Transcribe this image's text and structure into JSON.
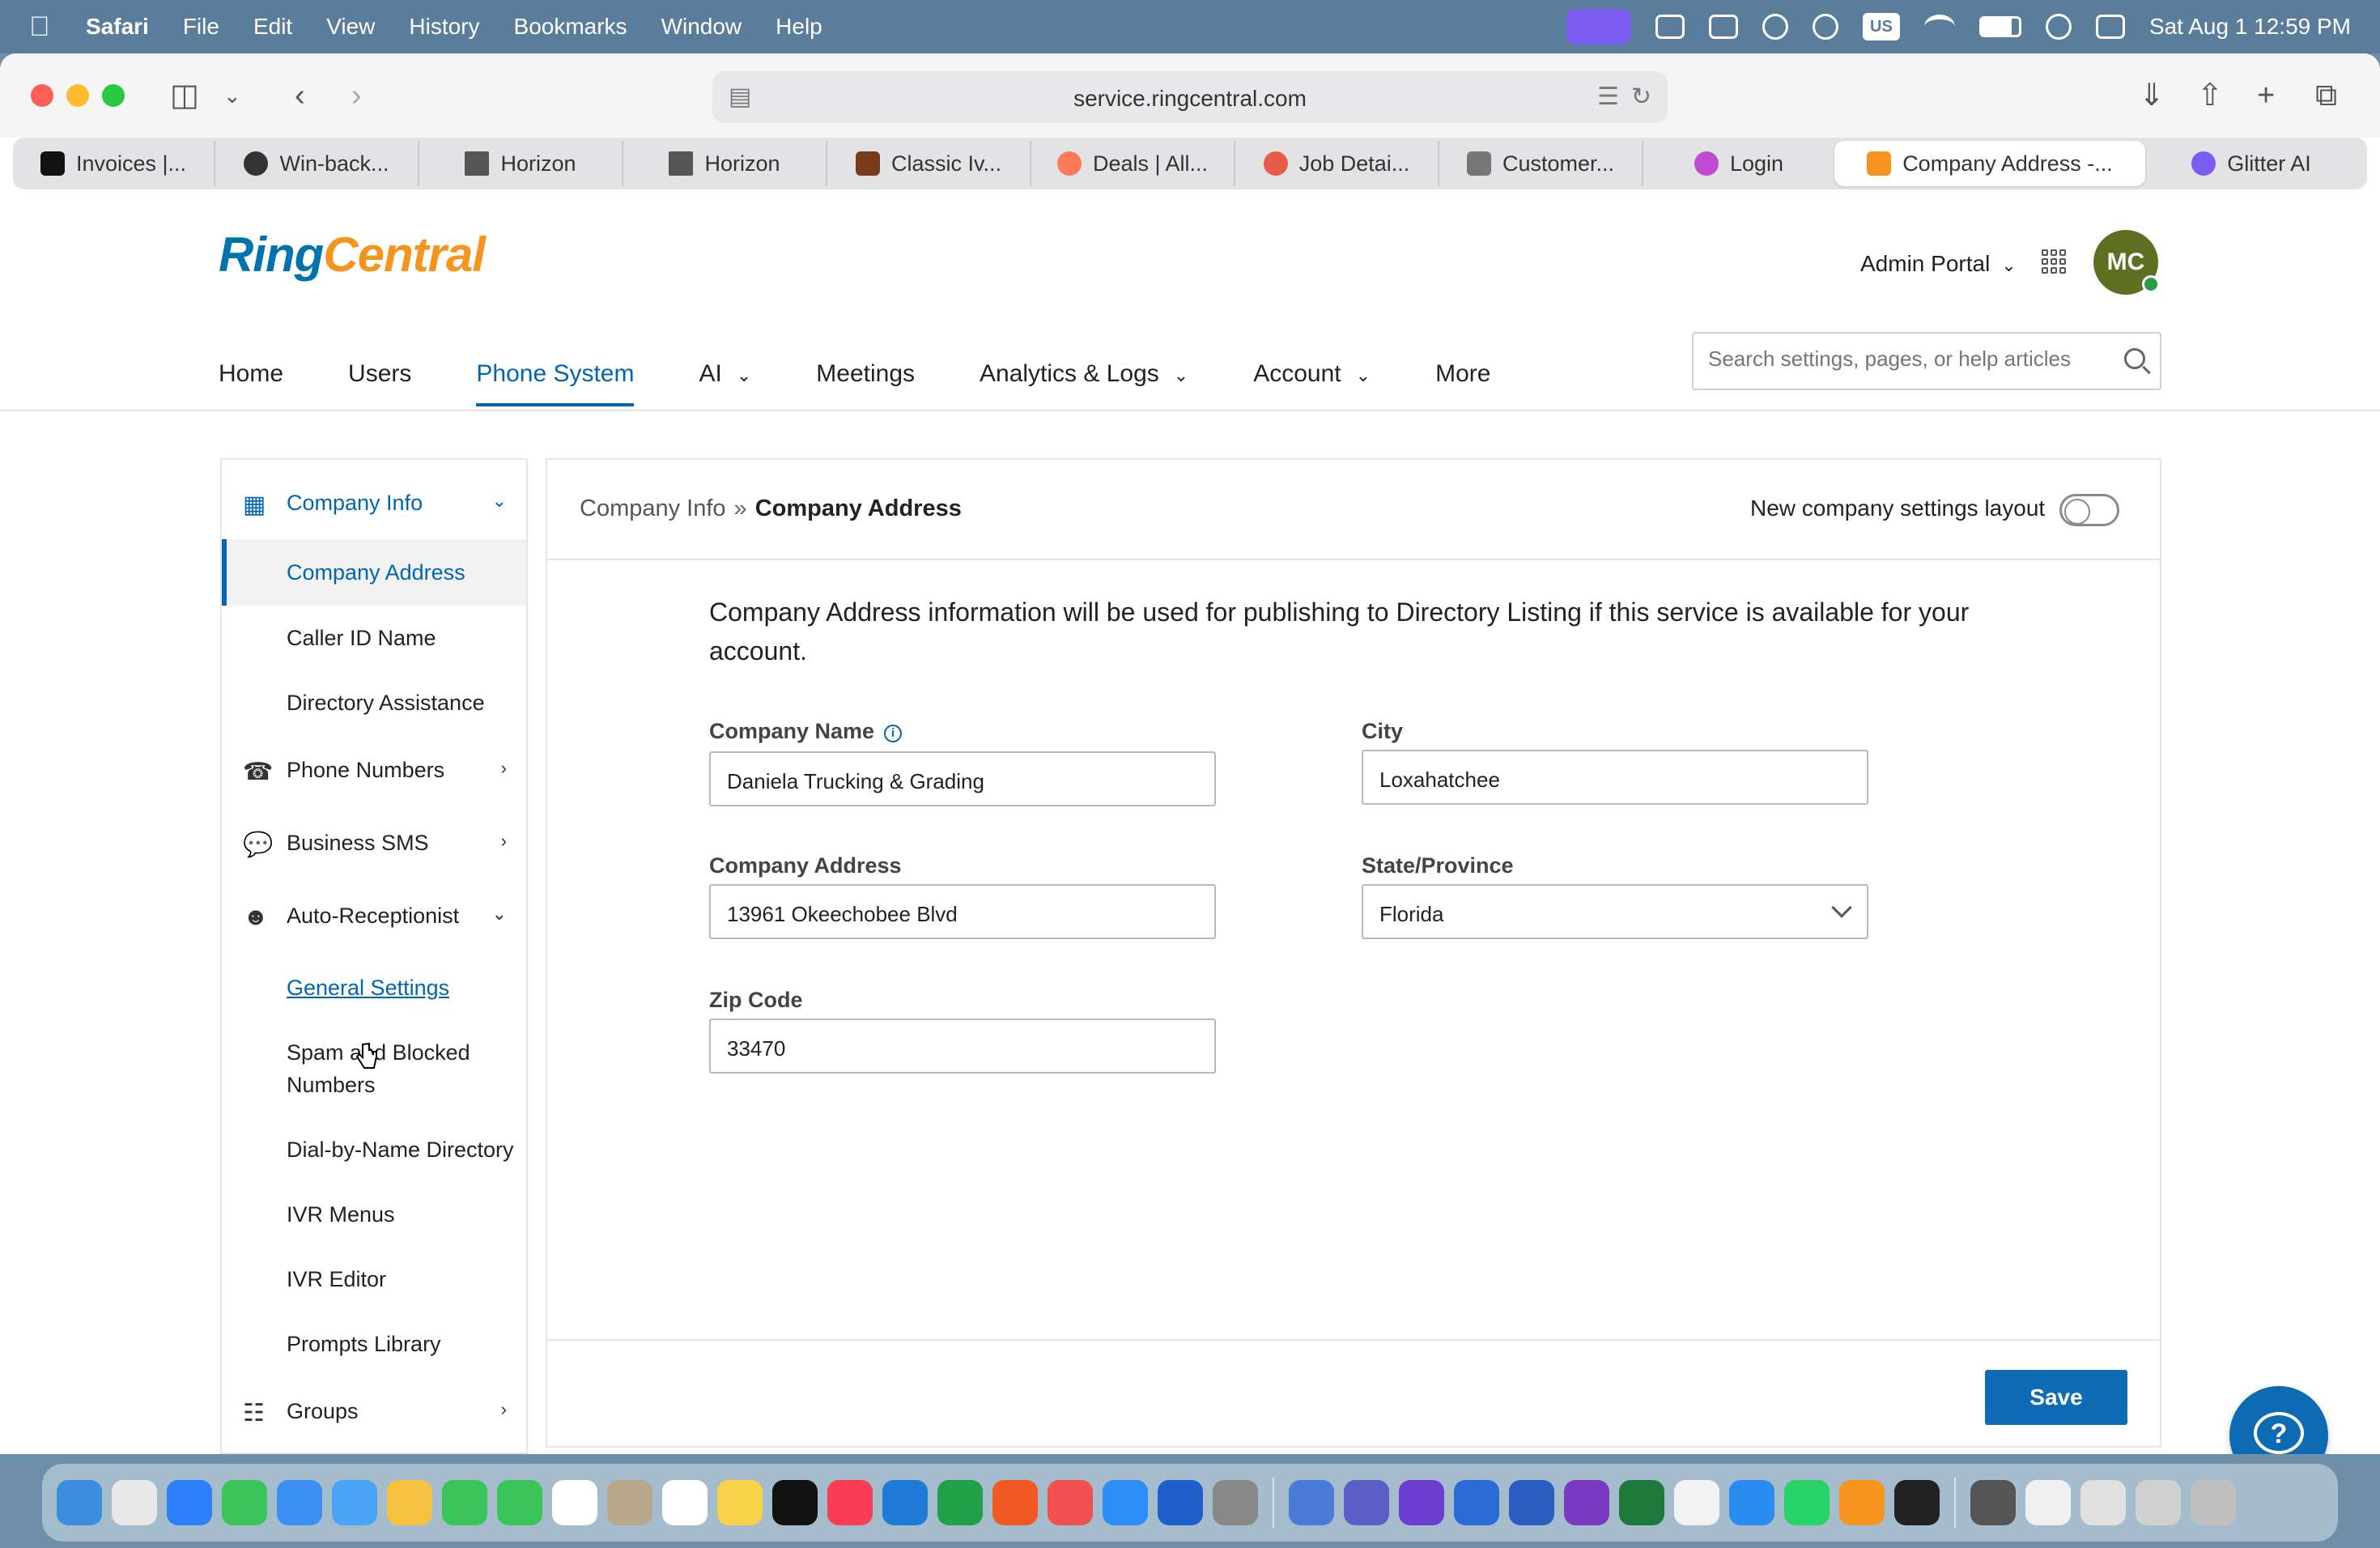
{
  "menubar": {
    "app_name": "Safari",
    "menus": [
      "File",
      "Edit",
      "View",
      "History",
      "Bookmarks",
      "Window",
      "Help"
    ],
    "keyboard_badge": "US",
    "clock": "Sat Aug 1  12:59 PM"
  },
  "browser": {
    "url": "service.ringcentral.com",
    "tabs": [
      {
        "label": "Invoices |...",
        "icon_color": "#111111"
      },
      {
        "label": "Win-back...",
        "icon_color": "#222222"
      },
      {
        "label": "Horizon",
        "icon_color": "#444444"
      },
      {
        "label": "Horizon",
        "icon_color": "#444444"
      },
      {
        "label": "Classic Iv...",
        "icon_color": "#7a3b1a"
      },
      {
        "label": "Deals | All...",
        "icon_color": "#ff7a59"
      },
      {
        "label": "Job Detai...",
        "icon_color": "#e85d4a"
      },
      {
        "label": "Customer...",
        "icon_color": "#666666"
      },
      {
        "label": "Login",
        "icon_color": "#c04ad0"
      },
      {
        "label": "Company Address -...",
        "icon_color": "#f7941d",
        "active": true
      },
      {
        "label": "Glitter AI",
        "icon_color": "#7b5cf0"
      }
    ]
  },
  "app": {
    "logo_ring": "Ring",
    "logo_central": "Central",
    "admin_portal": "Admin Portal",
    "avatar_initials": "MC",
    "nav": [
      {
        "label": "Home",
        "chevron": false
      },
      {
        "label": "Users",
        "chevron": false
      },
      {
        "label": "Phone System",
        "chevron": false,
        "active": true
      },
      {
        "label": "AI",
        "chevron": true
      },
      {
        "label": "Meetings",
        "chevron": false
      },
      {
        "label": "Analytics & Logs",
        "chevron": true
      },
      {
        "label": "Account",
        "chevron": true
      },
      {
        "label": "More",
        "chevron": false
      }
    ],
    "search_placeholder": "Search settings, pages, or help articles"
  },
  "sidebar": {
    "company_info": "Company Info",
    "company_address": "Company Address",
    "caller_id_name": "Caller ID Name",
    "directory_assistance": "Directory Assistance",
    "phone_numbers": "Phone Numbers",
    "business_sms": "Business SMS",
    "auto_receptionist": "Auto-Receptionist",
    "general_settings": "General Settings",
    "spam_blocked": "Spam and Blocked Numbers",
    "dial_by_name": "Dial-by-Name Directory",
    "ivr_menus": "IVR Menus",
    "ivr_editor": "IVR Editor",
    "prompts_library": "Prompts Library",
    "groups": "Groups"
  },
  "panel": {
    "breadcrumb_parent": "Company Info",
    "breadcrumb_sep": "»",
    "breadcrumb_current": "Company Address",
    "layout_toggle_label": "New company settings layout",
    "layout_toggle_on": false,
    "intro": "Company Address information will be used for publishing to Directory Listing if this service is available for your account.",
    "fields": {
      "company_name_label": "Company Name",
      "company_name_value": "Daniela Trucking & Grading",
      "city_label": "City",
      "city_value": "Loxahatchee",
      "company_address_label": "Company Address",
      "company_address_value": "13961 Okeechobee Blvd",
      "state_label": "State/Province",
      "state_value": "Florida",
      "zip_label": "Zip Code",
      "zip_value": "33470"
    },
    "save_label": "Save"
  },
  "dock": {
    "icon_colors": [
      "#3b8de0",
      "#e8e8e8",
      "#2d7ff9",
      "#3ac45a",
      "#3b8ff0",
      "#4ba3f5",
      "#f5c242",
      "#3ac45a",
      "#3ac45a",
      "#ffffff",
      "#b8a78a",
      "#ffffff",
      "#f8d34a",
      "#111111",
      "#fa3c55",
      "#1f7ad8",
      "#21a04a",
      "#f05a22",
      "#f05050",
      "#2d8ff5",
      "#1f5fcc",
      "#888888",
      "#4a7bd6",
      "#5b5fc7",
      "#6b3ecf",
      "#2b6bd6",
      "#2b5cbf",
      "#7a3bc2",
      "#1d7a3c",
      "#f2f2f2",
      "#2b8cf0",
      "#25d366",
      "#f7941d",
      "#222222",
      "#555555",
      "#f0f0f0",
      "#e0e0e0",
      "#d0d0d0",
      "#c0c0c0"
    ]
  }
}
